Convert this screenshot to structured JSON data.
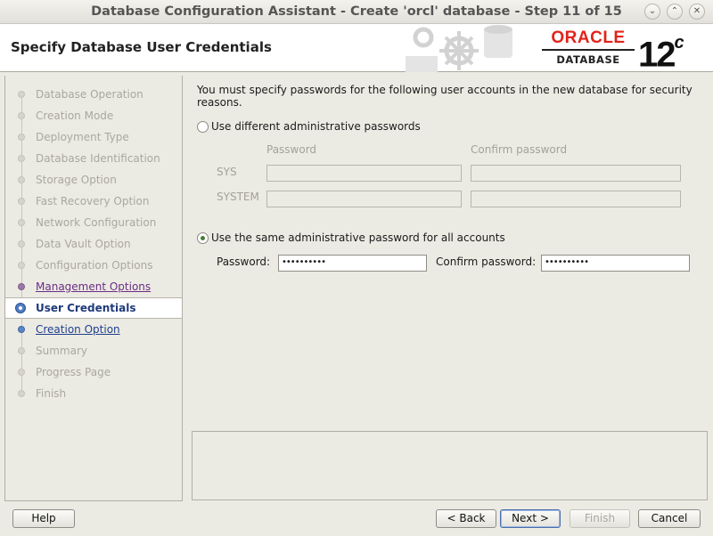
{
  "window": {
    "title": "Database Configuration Assistant - Create 'orcl' database - Step 11 of 15",
    "buttons": {
      "minimize": "⌄",
      "maximize": "⌃",
      "close": "✕"
    }
  },
  "header": {
    "page_title": "Specify Database User Credentials",
    "logo_word": "ORACLE",
    "logo_sub": "DATABASE",
    "version": "12",
    "version_suffix": "c",
    "brand_color": "#e2231a"
  },
  "sidebar": {
    "steps": [
      {
        "label": "Database Operation",
        "state": "done"
      },
      {
        "label": "Creation Mode",
        "state": "done"
      },
      {
        "label": "Deployment Type",
        "state": "done"
      },
      {
        "label": "Database Identification",
        "state": "done"
      },
      {
        "label": "Storage Option",
        "state": "done"
      },
      {
        "label": "Fast Recovery Option",
        "state": "done"
      },
      {
        "label": "Network Configuration",
        "state": "done"
      },
      {
        "label": "Data Vault Option",
        "state": "done"
      },
      {
        "label": "Configuration Options",
        "state": "done"
      },
      {
        "label": "Management Options",
        "state": "visited"
      },
      {
        "label": "User Credentials",
        "state": "current"
      },
      {
        "label": "Creation Option",
        "state": "next"
      },
      {
        "label": "Summary",
        "state": "pending"
      },
      {
        "label": "Progress Page",
        "state": "pending"
      },
      {
        "label": "Finish",
        "state": "pending"
      }
    ]
  },
  "content": {
    "intro": "You must specify passwords for the following user accounts in the new database for security reasons.",
    "option_different": "Use different administrative passwords",
    "col_password": "Password",
    "col_confirm": "Confirm password",
    "row_sys": "SYS",
    "row_system": "SYSTEM",
    "option_same": "Use the same administrative password for all accounts",
    "password_label": "Password:",
    "confirm_label": "Confirm password:",
    "password_value": "••••••••••",
    "confirm_value": "••••••••••",
    "selected_option": "same"
  },
  "footer": {
    "help": "Help",
    "back": "< Back",
    "next": "Next >",
    "finish": "Finish",
    "cancel": "Cancel"
  }
}
